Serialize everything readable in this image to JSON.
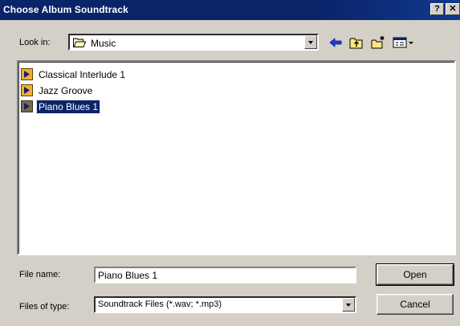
{
  "window": {
    "title": "Choose Album Soundtrack",
    "help_glyph": "?",
    "close_glyph": "✕"
  },
  "lookin": {
    "label": "Look in:",
    "value": "Music"
  },
  "toolbar": {
    "icons": [
      "back-arrow-icon",
      "up-folder-icon",
      "new-folder-icon",
      "view-menu-icon"
    ]
  },
  "files": [
    {
      "name": "Classical Interlude 1",
      "selected": false
    },
    {
      "name": "Jazz Groove",
      "selected": false
    },
    {
      "name": "Piano Blues 1",
      "selected": true
    }
  ],
  "filename": {
    "label": "File name:",
    "value": "Piano Blues 1"
  },
  "filetype": {
    "label": "Files of type:",
    "value": "Soundtrack Files (*.wav; *.mp3)"
  },
  "buttons": {
    "open": "Open",
    "cancel": "Cancel"
  },
  "colors": {
    "titlebar": "#0a246a",
    "selection": "#0a246a",
    "face": "#d4d0c8"
  }
}
